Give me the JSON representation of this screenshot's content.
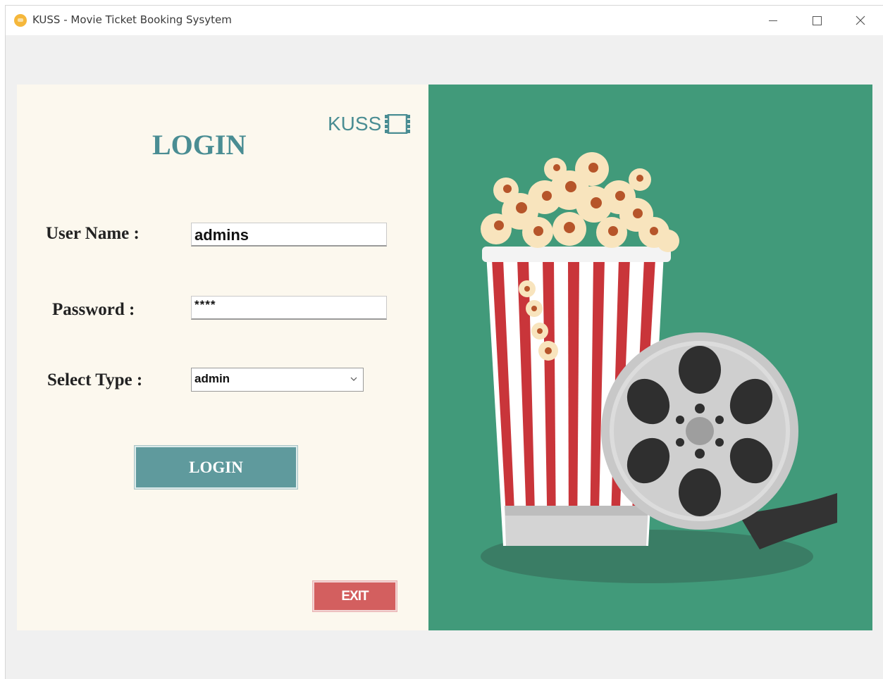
{
  "window": {
    "title": "KUSS - Movie Ticket Booking Sysytem",
    "controls": [
      "minimize",
      "maximize",
      "close"
    ]
  },
  "brand": {
    "logo_text": "KUSS"
  },
  "form": {
    "heading": "LOGIN",
    "username_label": "User Name :",
    "username_value": "admins",
    "password_label": "Password :",
    "password_value": "****",
    "type_label": "Select Type :",
    "type_value": "admin",
    "login_button": "LOGIN",
    "exit_button": "EXIT"
  },
  "colors": {
    "accent": "#4a8d93",
    "login_button": "#5f9a9d",
    "exit_button": "#d35f5f",
    "panel_left": "#fcf8ee",
    "panel_right": "#419a7a"
  },
  "icons": [
    "app-icon",
    "film-strip-icon",
    "chevron-down-icon",
    "popcorn-illustration",
    "film-reel-illustration"
  ]
}
